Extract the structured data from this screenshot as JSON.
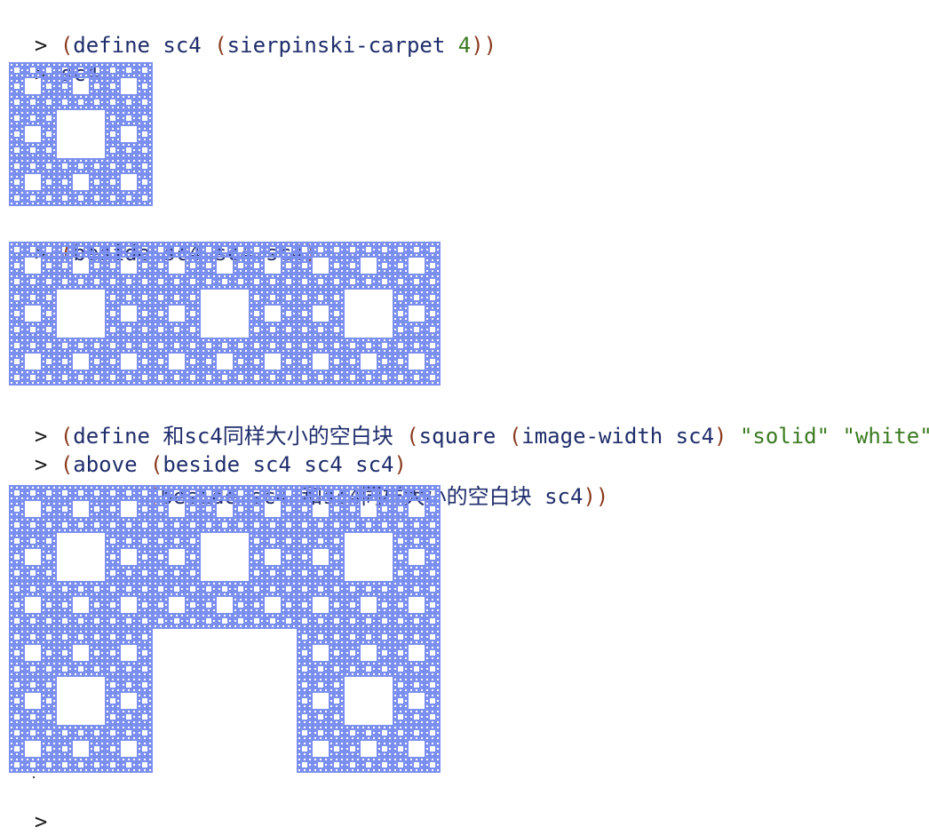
{
  "repl": {
    "prompt": ">",
    "lines": [
      {
        "tokens": [
          {
            "t": "(",
            "k": "paren"
          },
          {
            "t": "define sc4 ",
            "k": "sym"
          },
          {
            "t": "(",
            "k": "paren"
          },
          {
            "t": "sierpinski-carpet ",
            "k": "sym"
          },
          {
            "t": "4",
            "k": "lit"
          },
          {
            "t": "))",
            "k": "paren"
          }
        ]
      },
      {
        "tokens": [
          {
            "t": "sc4",
            "k": "sym"
          }
        ]
      },
      {
        "tokens": [
          {
            "t": "(",
            "k": "paren"
          },
          {
            "t": "beside sc4 sc4 sc4",
            "k": "sym"
          },
          {
            "t": ")",
            "k": "paren"
          }
        ]
      },
      {
        "tokens": [
          {
            "t": "(",
            "k": "paren"
          },
          {
            "t": "define 和sc4同样大小的空白块 ",
            "k": "sym"
          },
          {
            "t": "(",
            "k": "paren"
          },
          {
            "t": "square ",
            "k": "sym"
          },
          {
            "t": "(",
            "k": "paren"
          },
          {
            "t": "image-width sc4",
            "k": "sym"
          },
          {
            "t": ")",
            "k": "paren"
          },
          {
            "t": " ",
            "k": "sym"
          },
          {
            "t": "\"solid\" \"white\"",
            "k": "lit"
          },
          {
            "t": "))",
            "k": "paren"
          }
        ]
      },
      {
        "tokens": [
          {
            "t": "(",
            "k": "paren"
          },
          {
            "t": "above ",
            "k": "sym"
          },
          {
            "t": "(",
            "k": "paren"
          },
          {
            "t": "beside sc4 sc4 sc4",
            "k": "sym"
          },
          {
            "t": ")",
            "k": "paren"
          }
        ]
      },
      {
        "tokens": [
          {
            "t": "(",
            "k": "paren"
          },
          {
            "t": "beside sc4 和sc4同样大小的空白块 sc4",
            "k": "sym"
          },
          {
            "t": "))",
            "k": "paren"
          }
        ]
      }
    ]
  },
  "colors": {
    "carpet": "#7b8ff0",
    "paren": "#8b3a1e",
    "symbol": "#1f2d6b",
    "literal": "#3b7a20"
  }
}
